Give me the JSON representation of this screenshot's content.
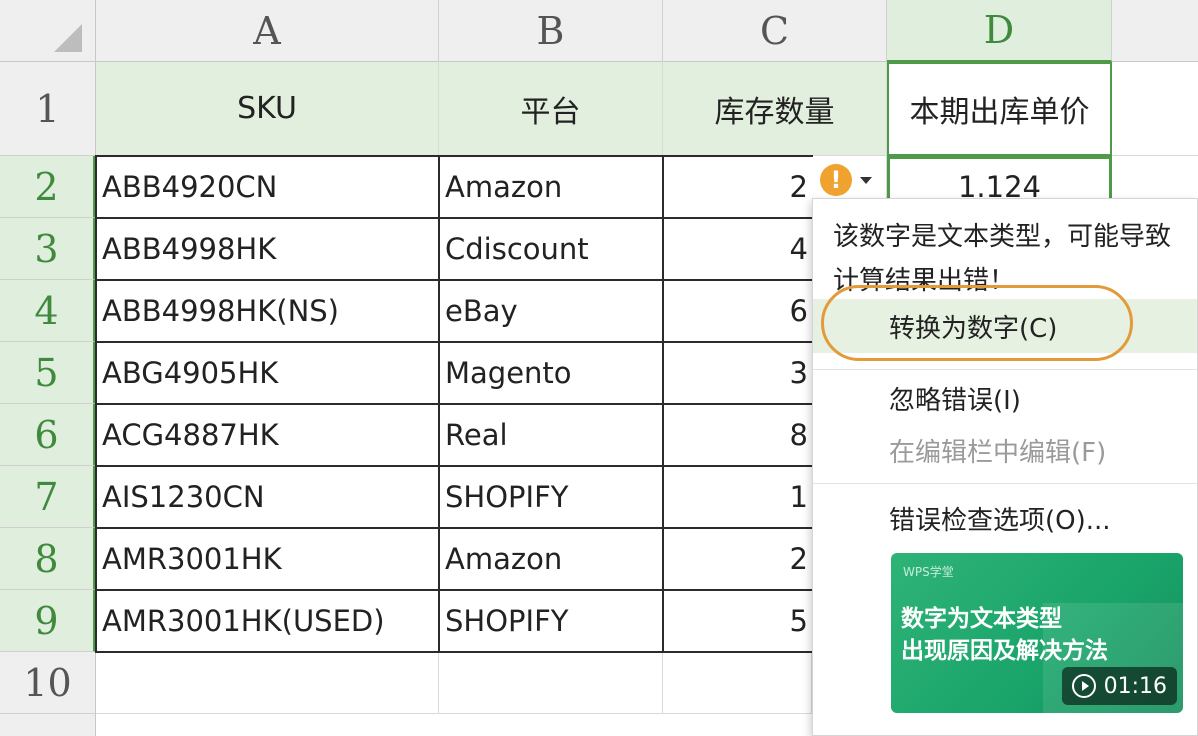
{
  "columns": [
    "A",
    "B",
    "C",
    "D"
  ],
  "header_row_label": "1",
  "headers": [
    "SKU",
    "平台",
    "库存数量",
    "本期出库单价"
  ],
  "rows": [
    {
      "num": "2",
      "sku": "ABB4920CN",
      "platform": "Amazon",
      "qty": "2",
      "price": "1.124"
    },
    {
      "num": "3",
      "sku": "ABB4998HK",
      "platform": "Cdiscount",
      "qty": "4"
    },
    {
      "num": "4",
      "sku": "ABB4998HK(NS)",
      "platform": "eBay",
      "qty": "6"
    },
    {
      "num": "5",
      "sku": "ABG4905HK",
      "platform": "Magento",
      "qty": "3"
    },
    {
      "num": "6",
      "sku": "ACG4887HK",
      "platform": "Real",
      "qty": "8"
    },
    {
      "num": "7",
      "sku": "AIS1230CN",
      "platform": "SHOPIFY",
      "qty": "1"
    },
    {
      "num": "8",
      "sku": "AMR3001HK",
      "platform": "Amazon",
      "qty": "2"
    },
    {
      "num": "9",
      "sku": "AMR3001HK(USED)",
      "platform": "SHOPIFY",
      "qty": "5"
    }
  ],
  "extra_row_label": "10",
  "warning": {
    "icon": "exclamation-icon",
    "symbol": "!",
    "color": "#f0a22f"
  },
  "popup": {
    "message": "该数字是文本类型，可能导致计算结果出错！",
    "items": {
      "convert": "转换为数字(C)",
      "ignore": "忽略错误(I)",
      "edit_in_bar": "在编辑栏中编辑(F)",
      "options": "错误检查选项(O)..."
    }
  },
  "video": {
    "brand": "WPS学堂",
    "title_line1": "数字为文本类型",
    "title_line2": "出现原因及解决方法",
    "duration": "01:16"
  },
  "colors": {
    "accent_green": "#4e9a48",
    "header_fill": "#e2efdf",
    "highlight_orange": "#e39a3a"
  }
}
